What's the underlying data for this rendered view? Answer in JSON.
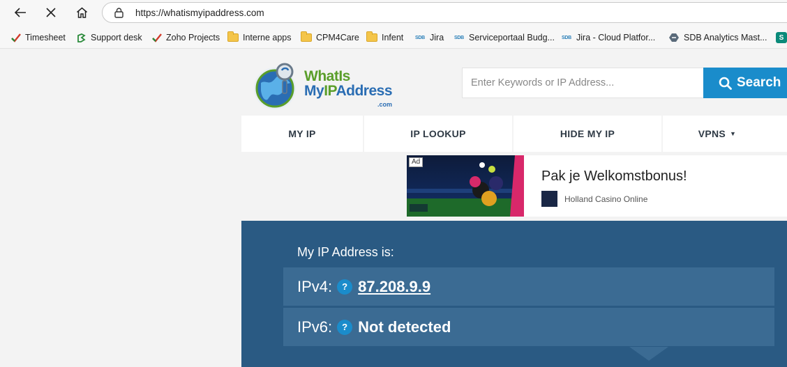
{
  "browser": {
    "url": "https://whatismyipaddress.com",
    "bookmarks": [
      {
        "label": "Timesheet",
        "icon": "zoho-check-icon"
      },
      {
        "label": "Support desk",
        "icon": "support-desk-icon"
      },
      {
        "label": "Zoho Projects",
        "icon": "zoho-check-icon"
      },
      {
        "label": "Interne apps",
        "icon": "folder-icon"
      },
      {
        "label": "CPM4Care",
        "icon": "folder-icon"
      },
      {
        "label": "Infent",
        "icon": "folder-icon"
      },
      {
        "label": "Jira",
        "icon": "sdb-icon"
      },
      {
        "label": "Serviceportaal Budg...",
        "icon": "sdb-icon"
      },
      {
        "label": "Jira - Cloud Platfor...",
        "icon": "sdb-icon"
      },
      {
        "label": "SDB Analytics Mast...",
        "icon": "analytics-icon"
      }
    ]
  },
  "site": {
    "logo": {
      "line1": "WhatIs",
      "line2_a": "My",
      "line2_b": "IP",
      "line2_c": "Address",
      "tld": ".com"
    },
    "search": {
      "placeholder": "Enter Keywords or IP Address...",
      "button": "Search"
    },
    "nav": [
      {
        "label": "MY IP"
      },
      {
        "label": "IP LOOKUP"
      },
      {
        "label": "HIDE MY IP"
      },
      {
        "label": "VPNS"
      }
    ],
    "ad": {
      "badge": "Ad",
      "title": "Pak je Welkomstbonus!",
      "brand": "Holland Casino Online"
    },
    "ip": {
      "heading": "My IP Address is:",
      "ipv4_label": "IPv4:",
      "ipv4_value": "87.208.9.9",
      "ipv6_label": "IPv6:",
      "ipv6_value": "Not detected",
      "help": "?"
    }
  },
  "colors": {
    "accent": "#1a8ccb",
    "panel": "#2a5a83",
    "row": "#3b6b93",
    "logo_green": "#5a9e2a",
    "logo_blue": "#2a6db3"
  }
}
